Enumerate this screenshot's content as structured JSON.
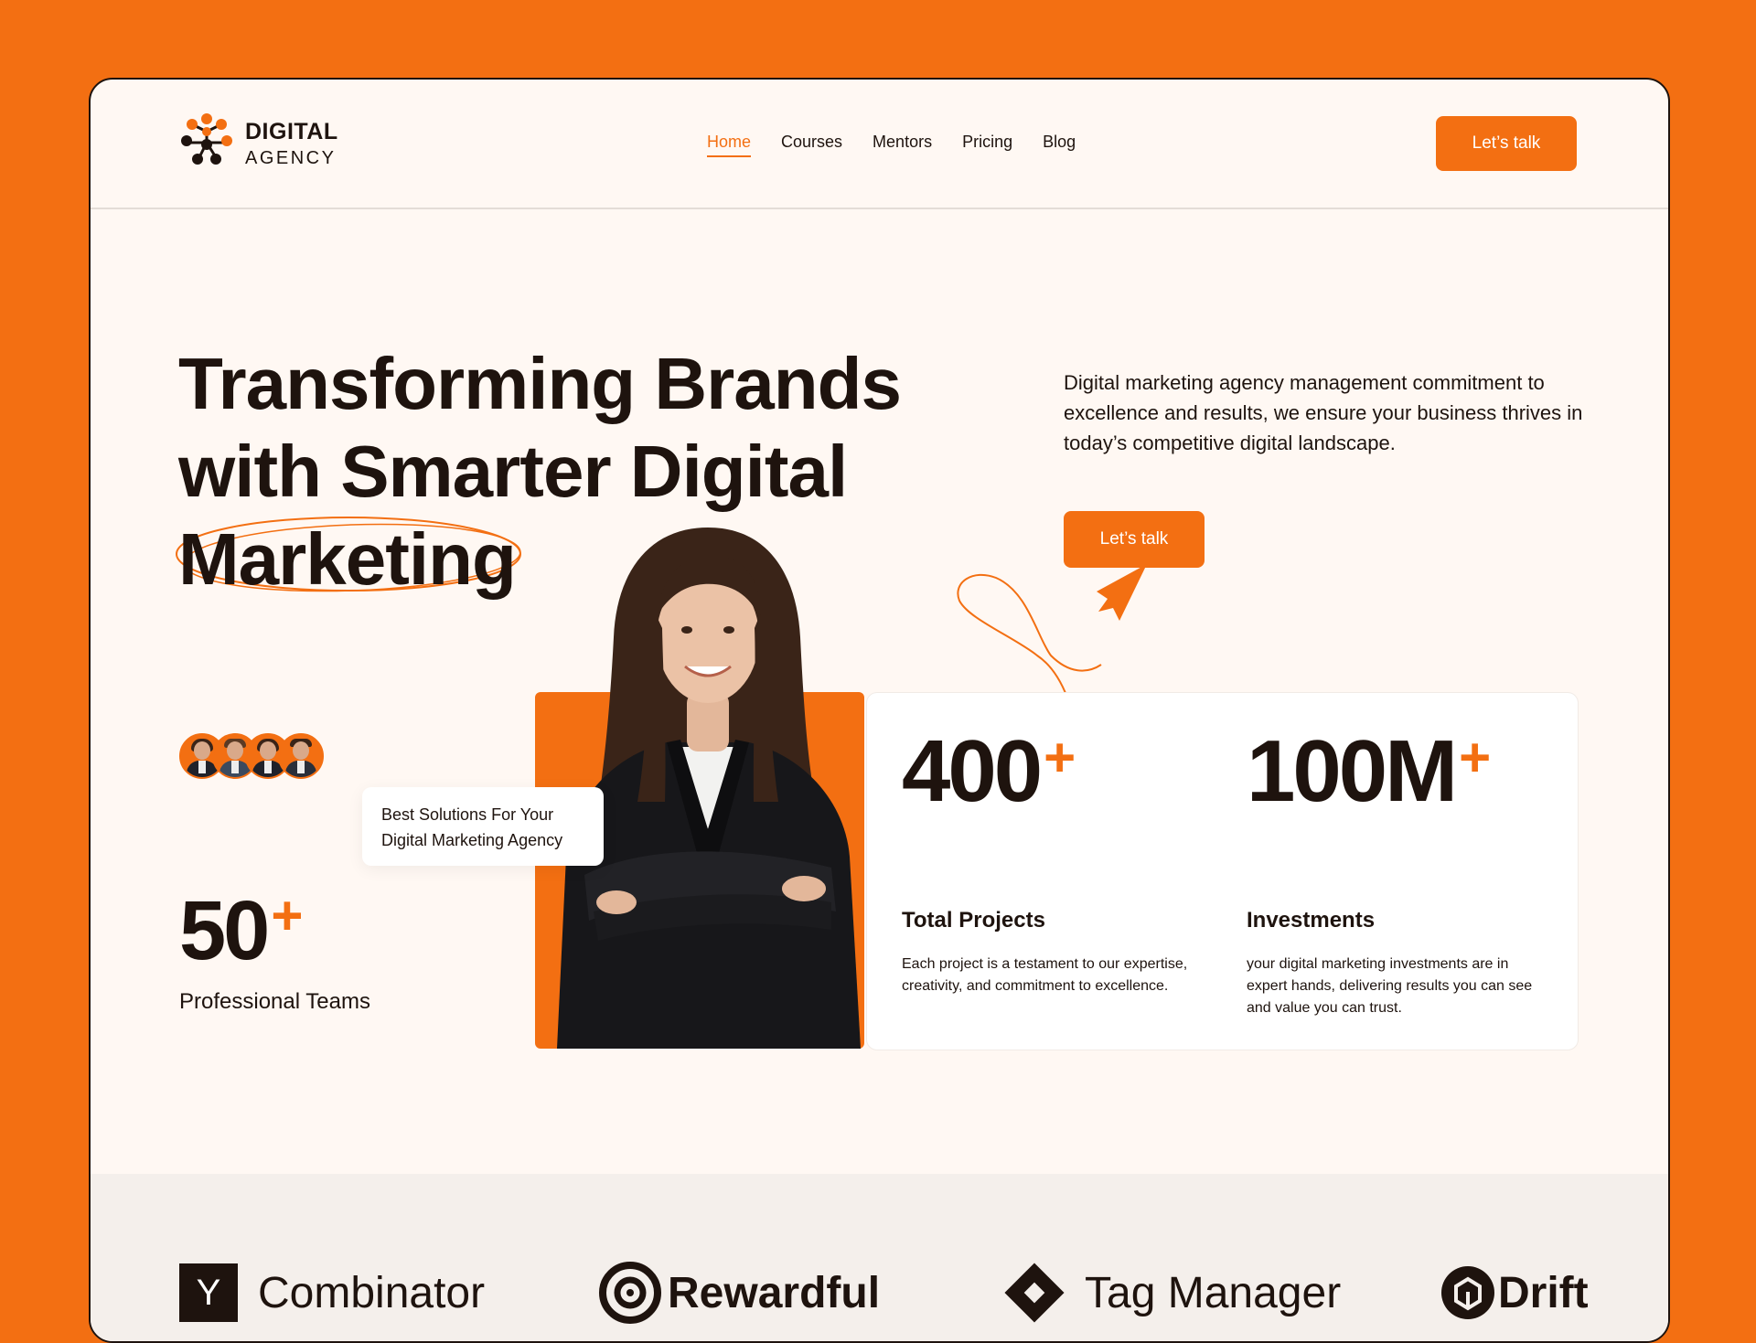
{
  "colors": {
    "accent": "#F36F12",
    "dark": "#1E130E",
    "page_bg": "#FFF8F3"
  },
  "brand": {
    "line1": "DIGITAL",
    "line2": "AGENCY"
  },
  "nav": {
    "items": [
      {
        "label": "Home",
        "active": true
      },
      {
        "label": "Courses"
      },
      {
        "label": "Mentors"
      },
      {
        "label": "Pricing"
      },
      {
        "label": "Blog"
      }
    ]
  },
  "header": {
    "cta_label": "Let’s talk"
  },
  "hero": {
    "title_line1": "Transforming Brands",
    "title_line2": "with Smarter Digital",
    "title_line3": "Marketing",
    "description": "Digital marketing agency management commitment to excellence and results, we ensure your business thrives in today’s competitive digital landscape.",
    "cta_label": "Let’s talk"
  },
  "badge": {
    "line1": "Best Solutions For Your",
    "line2": "Digital Marketing Agency"
  },
  "teams": {
    "value": "50",
    "plus": "+",
    "label": "Professional Teams"
  },
  "stats": [
    {
      "value": "400",
      "plus": "+",
      "title": "Total Projects",
      "description": "Each project is a testament to our expertise, creativity, and commitment to excellence."
    },
    {
      "value": "100M",
      "plus": "+",
      "title": "Investments",
      "description": "your digital marketing investments are in expert hands, delivering results you can see and value you can trust."
    }
  ],
  "partners": {
    "yc_letter": "Y",
    "yc_name": "Combinator",
    "rewardful": "Rewardful",
    "tag_manager": "Tag Manager",
    "drift": "Drift"
  },
  "icons": [
    "logo-mark-icon",
    "y-combinator-icon",
    "rewardful-icon",
    "tag-manager-icon",
    "drift-icon",
    "paper-plane-icon"
  ]
}
